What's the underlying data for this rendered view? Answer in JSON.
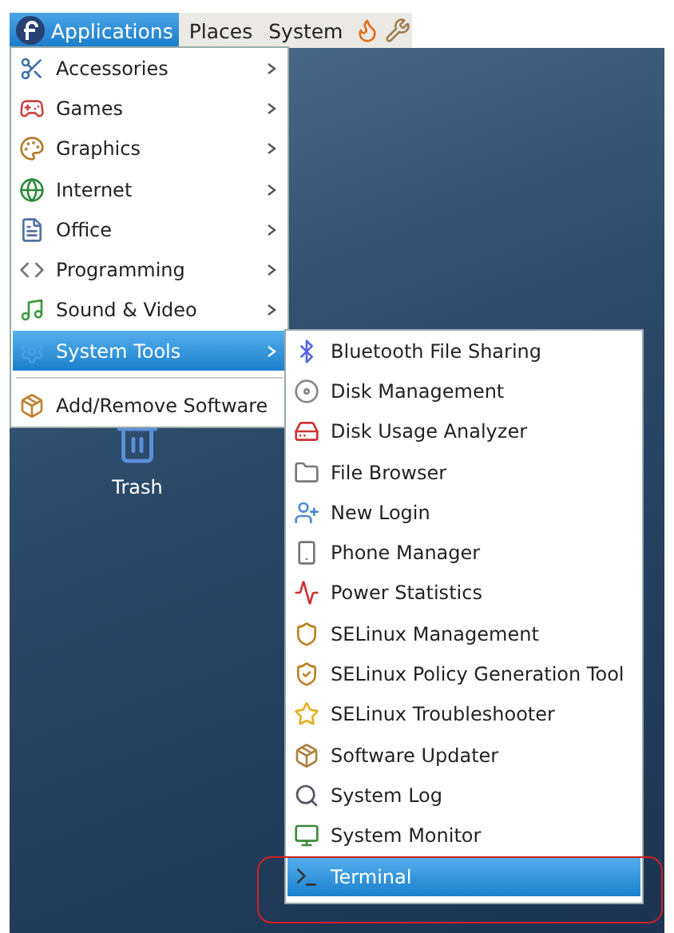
{
  "top_panel": {
    "items": [
      {
        "label": "Applications",
        "selected": true
      },
      {
        "label": "Places",
        "selected": false
      },
      {
        "label": "System",
        "selected": false
      }
    ]
  },
  "applications_menu": {
    "items": [
      {
        "label": "Accessories",
        "has_submenu": true,
        "selected": false
      },
      {
        "label": "Games",
        "has_submenu": true,
        "selected": false
      },
      {
        "label": "Graphics",
        "has_submenu": true,
        "selected": false
      },
      {
        "label": "Internet",
        "has_submenu": true,
        "selected": false
      },
      {
        "label": "Office",
        "has_submenu": true,
        "selected": false
      },
      {
        "label": "Programming",
        "has_submenu": true,
        "selected": false
      },
      {
        "label": "Sound & Video",
        "has_submenu": true,
        "selected": false
      },
      {
        "label": "System Tools",
        "has_submenu": true,
        "selected": true
      }
    ],
    "footer_items": [
      {
        "label": "Add/Remove Software",
        "has_submenu": false,
        "selected": false
      }
    ]
  },
  "system_tools_menu": {
    "items": [
      {
        "label": "Bluetooth File Sharing",
        "selected": false,
        "circled": false
      },
      {
        "label": "Disk Management",
        "selected": false,
        "circled": false
      },
      {
        "label": "Disk Usage Analyzer",
        "selected": false,
        "circled": false
      },
      {
        "label": "File Browser",
        "selected": false,
        "circled": false
      },
      {
        "label": "New Login",
        "selected": false,
        "circled": false
      },
      {
        "label": "Phone Manager",
        "selected": false,
        "circled": false
      },
      {
        "label": "Power Statistics",
        "selected": false,
        "circled": false
      },
      {
        "label": "SELinux Management",
        "selected": false,
        "circled": false
      },
      {
        "label": "SELinux Policy Generation Tool",
        "selected": false,
        "circled": false
      },
      {
        "label": "SELinux Troubleshooter",
        "selected": false,
        "circled": false
      },
      {
        "label": "Software Updater",
        "selected": false,
        "circled": false
      },
      {
        "label": "System Log",
        "selected": false,
        "circled": false
      },
      {
        "label": "System Monitor",
        "selected": false,
        "circled": false
      },
      {
        "label": "Terminal",
        "selected": true,
        "circled": true
      }
    ]
  },
  "desktop_icons": [
    {
      "label": "Trash"
    }
  ]
}
